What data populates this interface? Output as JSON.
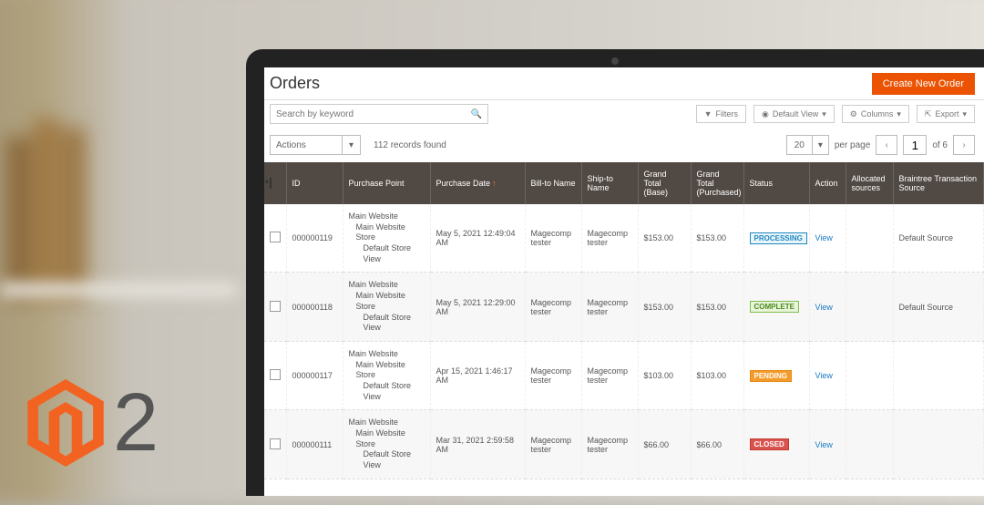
{
  "header": {
    "title": "Orders",
    "create_label": "Create New Order"
  },
  "search": {
    "placeholder": "Search by keyword"
  },
  "controls": {
    "filters": "Filters",
    "default_view": "Default View",
    "columns": "Columns",
    "export": "Export"
  },
  "actions_label": "Actions",
  "records_found": "112 records found",
  "pager": {
    "per_page_value": "20",
    "per_page_label": "per page",
    "page": "1",
    "total_label": "of 6"
  },
  "columns": {
    "id": "ID",
    "purchase_point": "Purchase Point",
    "purchase_date": "Purchase Date",
    "bill_to": "Bill-to Name",
    "ship_to": "Ship-to Name",
    "grand_total_base": "Grand Total (Base)",
    "grand_total_purchased": "Grand Total (Purchased)",
    "status": "Status",
    "action": "Action",
    "allocated": "Allocated sources",
    "braintree": "Braintree Transaction Source"
  },
  "purchase_point": {
    "l1": "Main Website",
    "l2": "Main Website Store",
    "l3": "Default Store View"
  },
  "view_label": "View",
  "default_source": "Default Source",
  "rows": [
    {
      "id": "000000119",
      "date": "May 5, 2021 12:49:04 AM",
      "bill": "Magecomp tester",
      "ship": "Magecomp tester",
      "gtb": "$153.00",
      "gtp": "$153.00",
      "status": "PROCESSING",
      "status_class": "st-processing",
      "src": true
    },
    {
      "id": "000000118",
      "date": "May 5, 2021 12:29:00 AM",
      "bill": "Magecomp tester",
      "ship": "Magecomp tester",
      "gtb": "$153.00",
      "gtp": "$153.00",
      "status": "COMPLETE",
      "status_class": "st-complete",
      "src": true
    },
    {
      "id": "000000117",
      "date": "Apr 15, 2021 1:46:17 AM",
      "bill": "Magecomp tester",
      "ship": "Magecomp tester",
      "gtb": "$103.00",
      "gtp": "$103.00",
      "status": "PENDING",
      "status_class": "st-pending",
      "src": false
    },
    {
      "id": "000000111",
      "date": "Mar 31, 2021 2:59:58 AM",
      "bill": "Magecomp tester",
      "ship": "Magecomp tester",
      "gtb": "$66.00",
      "gtp": "$66.00",
      "status": "CLOSED",
      "status_class": "st-closed",
      "src": false
    }
  ],
  "logo_two": "2"
}
